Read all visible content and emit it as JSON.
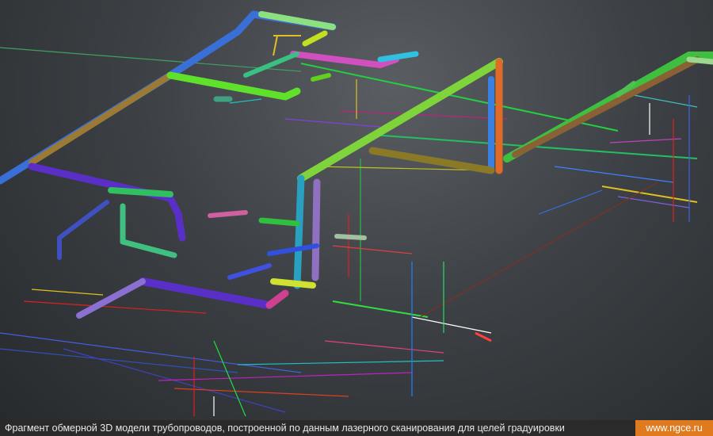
{
  "caption": "Фрагмент обмерной 3D модели трубопроводов, построенной по данным лазерного сканирования для целей градуировки",
  "site": "www.ngce.ru",
  "colors": {
    "brand": "#e07a1f",
    "caption_bg": "#2a2a2a",
    "pipe_green": "#5fe02a",
    "pipe_blue": "#3a6fd8",
    "pipe_purple": "#5a2fc8",
    "pipe_orange": "#e06a28",
    "pipe_olive": "#8a7a28"
  }
}
